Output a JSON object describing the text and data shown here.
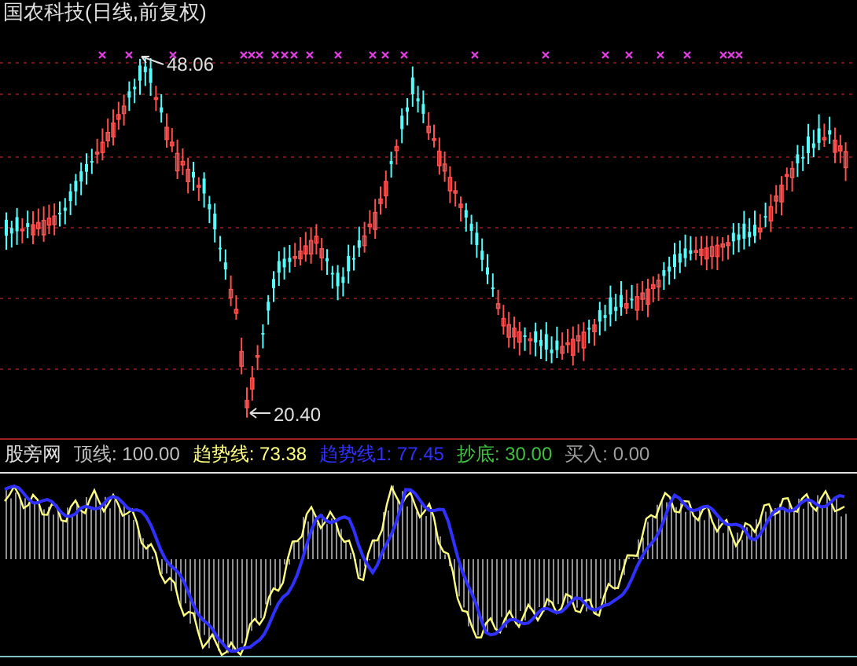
{
  "title": "国农科技(日线,前复权)",
  "price_labels": {
    "high": "48.06",
    "low": "20.40"
  },
  "indicator": {
    "name": "股旁网",
    "values": [
      {
        "label": "顶线: 100.00",
        "color": "#c0c0c0"
      },
      {
        "label": "趋势线: 73.38",
        "color": "#ffff80"
      },
      {
        "label": "趋势线1: 77.45",
        "color": "#3030ff"
      },
      {
        "label": "抄底: 30.00",
        "color": "#40c040"
      },
      {
        "label": "买入: 0.00",
        "color": "#a0a0a0"
      }
    ]
  }
}
